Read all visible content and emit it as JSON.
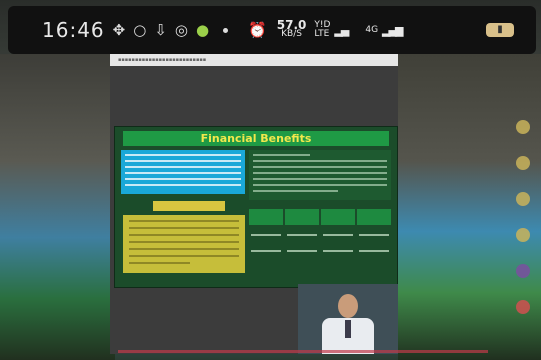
{
  "status_bar": {
    "time": "16:46",
    "network_speed_value": "57.0",
    "network_speed_unit": "KB/S",
    "volte_top": "Y!D",
    "volte_bottom": "LTE",
    "network_type": "4G"
  },
  "slide": {
    "title": "Financial Benefits"
  },
  "colors": {
    "slide_background": "#1b4c2a",
    "title_bar": "#1f9a45",
    "title_text": "#f2e84c",
    "left_panel": "#1aa8d8",
    "yellow_panel": "#c6be3a"
  }
}
